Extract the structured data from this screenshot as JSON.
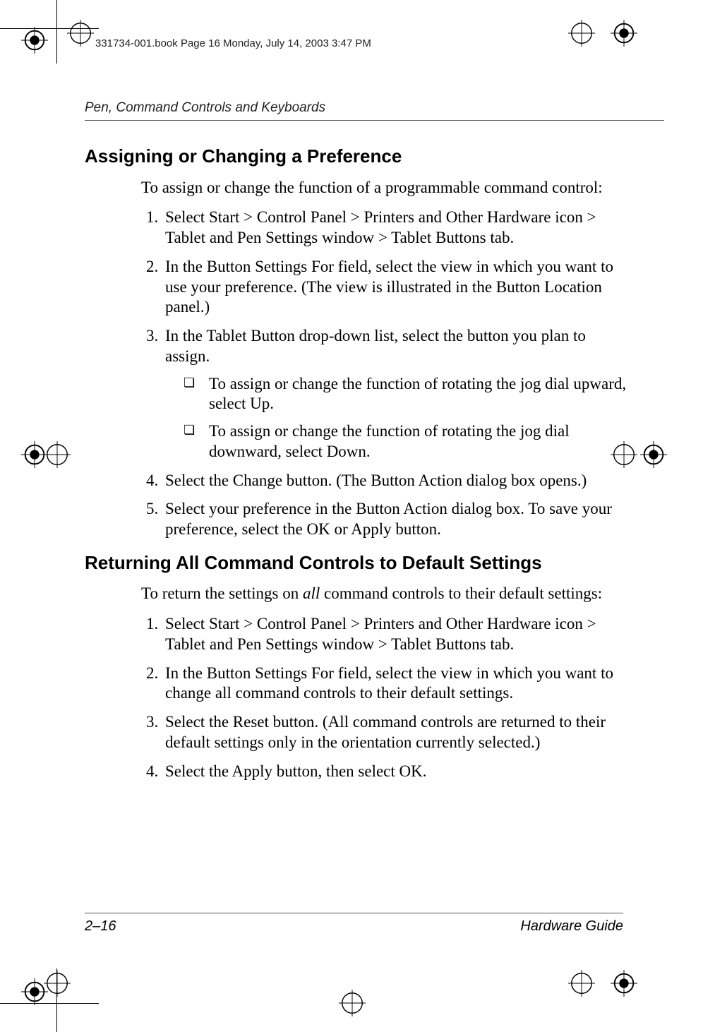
{
  "meta_line": "331734-001.book  Page 16  Monday, July 14, 2003  3:47 PM",
  "running_head": "Pen, Command Controls and Keyboards",
  "footer": {
    "left": "2–16",
    "right": "Hardware Guide"
  },
  "section1": {
    "title": "Assigning or Changing a Preference",
    "intro": "To assign or change the function of a programmable command control:",
    "steps": [
      "Select Start > Control Panel > Printers and Other Hardware icon > Tablet and Pen Settings window > Tablet Buttons tab.",
      "In the Button Settings For field, select the view in which you want to use your preference. (The view is illustrated in the Button Location panel.)",
      "In the Tablet Button drop-down list, select the button you plan to assign.",
      "Select the Change button. (The Button Action dialog box opens.)",
      "Select your preference in the Button Action dialog box. To save your preference, select the OK or Apply button."
    ],
    "sub_after_step": 3,
    "sub": [
      "To assign or change the function of rotating the jog dial upward, select Up.",
      "To assign or change the function of rotating the jog dial downward, select Down."
    ]
  },
  "section2": {
    "title": "Returning All Command Controls to Default Settings",
    "intro_pre": "To return the settings on ",
    "intro_em": "all",
    "intro_post": " command controls to their default settings:",
    "steps": [
      "Select Start > Control Panel > Printers and Other Hardware icon > Tablet and Pen Settings window > Tablet Buttons tab.",
      "In the Button Settings For field, select the view in which you want to change all command controls to their default settings.",
      "Select the Reset button. (All command controls are returned to their default settings only in the orientation currently selected.)",
      "Select the Apply button, then select OK."
    ]
  }
}
